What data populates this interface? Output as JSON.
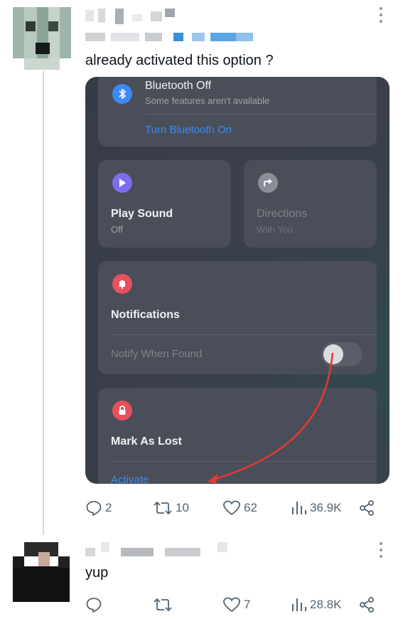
{
  "tweet1": {
    "text": "already activated this option ?",
    "stats": {
      "replies": "2",
      "retweets": "10",
      "likes": "62",
      "views": "36.9K"
    }
  },
  "embed": {
    "bluetooth": {
      "title": "Bluetooth Off",
      "subtitle": "Some features aren't available",
      "link": "Turn Bluetooth On"
    },
    "play_sound": {
      "title": "Play Sound",
      "subtitle": "Off"
    },
    "directions": {
      "title": "Directions",
      "subtitle": "With You"
    },
    "notifications": {
      "title": "Notifications",
      "option": "Notify When Found"
    },
    "mark_as_lost": {
      "title": "Mark As Lost",
      "link": "Activate"
    }
  },
  "tweet2": {
    "text": "yup",
    "stats": {
      "likes": "7",
      "views": "28.8K"
    }
  },
  "colors": {
    "accent_blue": "#3a8bf6",
    "play_purple": "#7b6cf0",
    "alert_red": "#e8505b",
    "arrow_red": "#e53935",
    "muted": "#536471"
  },
  "icons": [
    "more-icon",
    "bluetooth-icon",
    "play-icon",
    "directions-icon",
    "bell-icon",
    "lock-icon",
    "reply-icon",
    "retweet-icon",
    "heart-icon",
    "views-icon",
    "share-icon"
  ]
}
